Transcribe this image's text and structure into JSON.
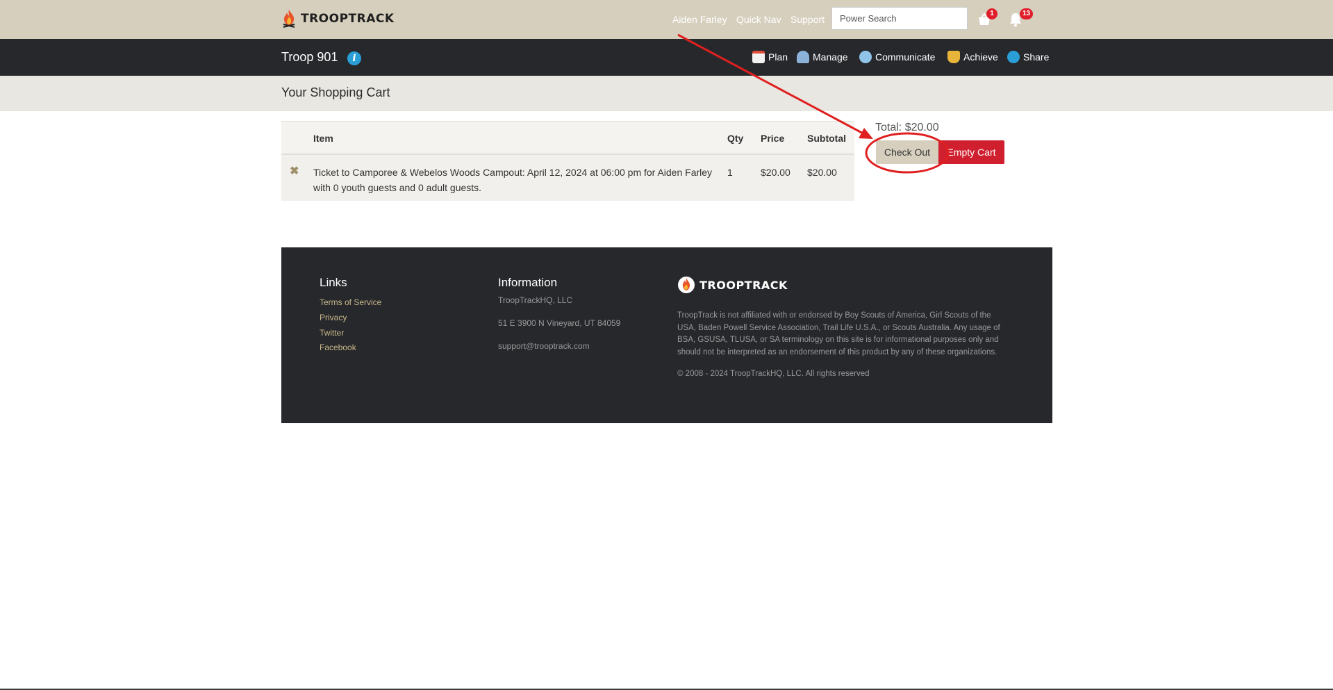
{
  "header": {
    "logo_text": "TROOPTRACK",
    "user_link": "Aiden Farley",
    "quicknav_link": "Quick Nav",
    "support_link": "Support",
    "search_placeholder": "Power Search",
    "cart_badge": "1",
    "notifications_badge": "13"
  },
  "nav": {
    "troop_name": "Troop 901",
    "items": [
      {
        "label": "Plan",
        "icon": "calendar-icon"
      },
      {
        "label": "Manage",
        "icon": "people-icon"
      },
      {
        "label": "Communicate",
        "icon": "chat-bubbles-icon"
      },
      {
        "label": "Achieve",
        "icon": "trophy-icon"
      },
      {
        "label": "Share",
        "icon": "share-icon"
      }
    ]
  },
  "page": {
    "title": "Your Shopping Cart"
  },
  "cart": {
    "columns": [
      "Item",
      "Qty",
      "Price",
      "Subtotal"
    ],
    "rows": [
      {
        "item_line1": "Ticket to Camporee & Webelos Woods Campout: April 12, 2024 at 06:00 pm for Aiden Farley",
        "item_line2": "with 0 youth guests and 0 adult guests.",
        "qty": "1",
        "price": "$20.00",
        "subtotal": "$20.00"
      }
    ],
    "total": "Total: $20.00",
    "checkout_label": "Check Out",
    "empty_label": "Empty Cart"
  },
  "footer": {
    "links_heading": "Links",
    "links": [
      "Terms of Service",
      "Privacy",
      "Twitter",
      "Facebook"
    ],
    "info_heading": "Information",
    "info": [
      "TroopTrackHQ, LLC",
      "51 E 3900 N Vineyard, UT 84059",
      "support@trooptrack.com"
    ],
    "logo_text": "TROOPTRACK",
    "disclaimer": "TroopTrack is not affiliated with or endorsed by Boy Scouts of America, Girl Scouts of the USA, Baden Powell Service Association, Trail Life U.S.A., or Scouts Australia. Any usage of BSA, GSUSA, TLUSA, or SA terminology on this site is for informational purposes only and should not be interpreted as an endorsement of this product by any of these organizations.",
    "copyright": "© 2008 - 2024 TroopTrackHQ, LLC. All rights reserved"
  },
  "colors": {
    "header_bg": "#d6cfbd",
    "nav_bg": "#27282c",
    "accent_red": "#d0202f",
    "annotation_red": "#e02020"
  }
}
